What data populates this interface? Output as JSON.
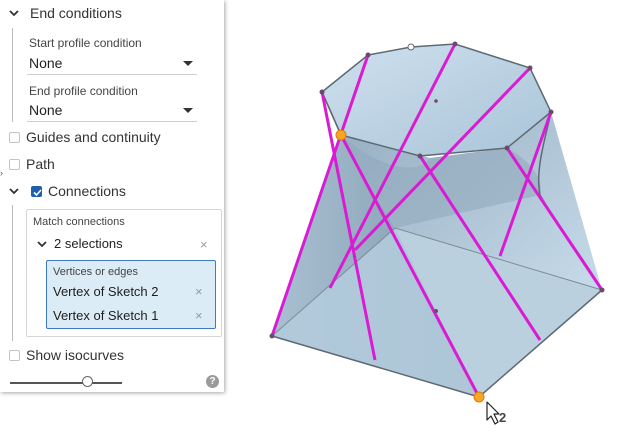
{
  "panel": {
    "end_conditions": {
      "label": "End conditions",
      "start_label": "Start profile condition",
      "start_value": "None",
      "end_label": "End profile condition",
      "end_value": "None"
    },
    "guides": {
      "label": "Guides and continuity",
      "checked": false
    },
    "path": {
      "label": "Path",
      "checked": false
    },
    "connections": {
      "label": "Connections",
      "checked": true,
      "match_label": "Match connections",
      "selections_label": "2 selections",
      "vertices_label": "Vertices or edges",
      "items": [
        "Vertex of Sketch 2",
        "Vertex of Sketch 1"
      ]
    },
    "isocurves": {
      "label": "Show isocurves",
      "checked": false
    },
    "help_glyph": "?",
    "edge_glyph": "›"
  },
  "viewport": {
    "cursor_count": "2",
    "colors": {
      "face": "#b7cfe0",
      "edge": "#5d6a75",
      "connection": "#d91bd3",
      "vertex": "#f5a623"
    }
  }
}
